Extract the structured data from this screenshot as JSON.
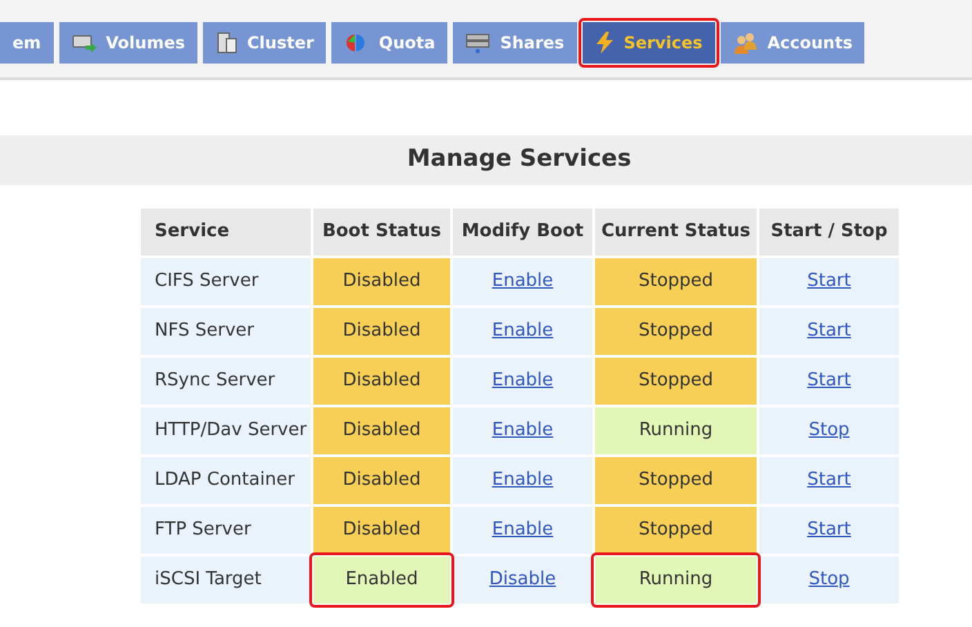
{
  "tabs": [
    {
      "label": "em",
      "selected": false,
      "highlighted": false
    },
    {
      "label": "Volumes",
      "selected": false,
      "highlighted": false
    },
    {
      "label": "Cluster",
      "selected": false,
      "highlighted": false
    },
    {
      "label": "Quota",
      "selected": false,
      "highlighted": false
    },
    {
      "label": "Shares",
      "selected": false,
      "highlighted": false
    },
    {
      "label": "Services",
      "selected": true,
      "highlighted": true
    },
    {
      "label": "Accounts",
      "selected": false,
      "highlighted": false
    }
  ],
  "heading": "Manage Services",
  "table": {
    "columns": [
      "Service",
      "Boot Status",
      "Modify Boot",
      "Current Status",
      "Start / Stop"
    ],
    "rows": [
      {
        "service": "CIFS Server",
        "boot_status": "Disabled",
        "boot_enabled": false,
        "boot_highlighted": false,
        "modify_link": "Enable",
        "current_status": "Stopped",
        "running": false,
        "status_highlighted": false,
        "action_link": "Start"
      },
      {
        "service": "NFS Server",
        "boot_status": "Disabled",
        "boot_enabled": false,
        "boot_highlighted": false,
        "modify_link": "Enable",
        "current_status": "Stopped",
        "running": false,
        "status_highlighted": false,
        "action_link": "Start"
      },
      {
        "service": "RSync Server",
        "boot_status": "Disabled",
        "boot_enabled": false,
        "boot_highlighted": false,
        "modify_link": "Enable",
        "current_status": "Stopped",
        "running": false,
        "status_highlighted": false,
        "action_link": "Start"
      },
      {
        "service": "HTTP/Dav Server",
        "boot_status": "Disabled",
        "boot_enabled": false,
        "boot_highlighted": false,
        "modify_link": "Enable",
        "current_status": "Running",
        "running": true,
        "status_highlighted": false,
        "action_link": "Stop"
      },
      {
        "service": "LDAP Container",
        "boot_status": "Disabled",
        "boot_enabled": false,
        "boot_highlighted": false,
        "modify_link": "Enable",
        "current_status": "Stopped",
        "running": false,
        "status_highlighted": false,
        "action_link": "Start"
      },
      {
        "service": "FTP Server",
        "boot_status": "Disabled",
        "boot_enabled": false,
        "boot_highlighted": false,
        "modify_link": "Enable",
        "current_status": "Stopped",
        "running": false,
        "status_highlighted": false,
        "action_link": "Start"
      },
      {
        "service": "iSCSI Target",
        "boot_status": "Enabled",
        "boot_enabled": true,
        "boot_highlighted": true,
        "modify_link": "Disable",
        "current_status": "Running",
        "running": true,
        "status_highlighted": true,
        "action_link": "Stop"
      }
    ]
  }
}
